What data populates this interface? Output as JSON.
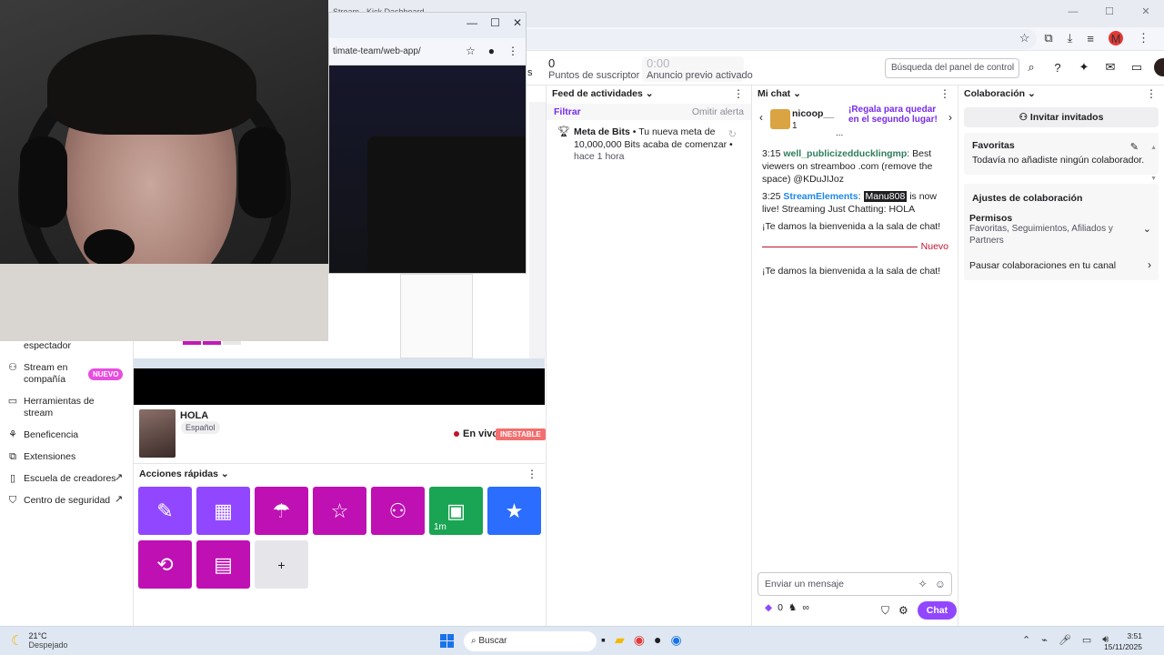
{
  "browser": {
    "tab_title": "Stream - Kick Dashboard",
    "profile_initial": "M",
    "window_controls": [
      "—",
      "☐",
      "✕"
    ]
  },
  "nested_window": {
    "url": "timate-team/web-app/",
    "controls": [
      "—",
      "☐",
      "✕"
    ]
  },
  "top_bar": {
    "stats": [
      {
        "value": "0",
        "label": "Puntos de suscriptor"
      },
      {
        "value": "0:00",
        "label": "Anuncio previo activado"
      }
    ],
    "stat_prefix": "s",
    "search_placeholder": "Búsqueda del panel de control"
  },
  "sidebar": {
    "items": [
      {
        "label": "espectador",
        "icon": "eye-icon"
      },
      {
        "label": "Stream en compañía",
        "icon": "person-plus-icon",
        "badge": "NUEVO"
      },
      {
        "label": "Herramientas de stream",
        "icon": "camera-icon"
      },
      {
        "label": "Beneficencia",
        "icon": "charity-icon"
      },
      {
        "label": "Extensiones",
        "icon": "puzzle-icon"
      },
      {
        "label": "Escuela de creadores",
        "icon": "book-icon",
        "external": true
      },
      {
        "label": "Centro de seguridad",
        "icon": "shield-icon",
        "external": true
      }
    ]
  },
  "stream": {
    "title": "HOLA",
    "language": "Español",
    "status": "En vivo",
    "health": "INESTABLE"
  },
  "quick_actions": {
    "title": "Acciones rápidas",
    "tiles": [
      {
        "icon": "pencil-icon",
        "color": "#9147ff"
      },
      {
        "icon": "clapper-icon",
        "color": "#9147ff"
      },
      {
        "icon": "predictions-icon",
        "color": "#bf10b4"
      },
      {
        "icon": "star-icon",
        "color": "#bf10b4"
      },
      {
        "icon": "add-person-icon",
        "color": "#bf10b4"
      },
      {
        "icon": "ad-icon",
        "color": "#19a553",
        "sub": "1m"
      },
      {
        "icon": "star-icon",
        "color": "#2b6dff"
      },
      {
        "icon": "reset-icon",
        "color": "#bf10b4"
      },
      {
        "icon": "layout-icon",
        "color": "#bf10b4"
      },
      {
        "icon": "plus-icon",
        "color": "#e6e6ea",
        "label": "+"
      }
    ]
  },
  "activity": {
    "title": "Feed de actividades",
    "filter": "Filtrar",
    "skip": "Omitir alerta",
    "event_title": "Meta de Bits",
    "event_text": "Tu nueva meta de 10,000,000 Bits acaba de comenzar",
    "event_time": "hace 1 hora"
  },
  "chat": {
    "title": "Mi chat",
    "gift_user": "nicoop__",
    "gift_count": "1",
    "gift_message": "¡Regala para quedar en el segundo lugar!",
    "gift_more": "...",
    "messages": [
      {
        "time": "3:15",
        "user": "well_publicizedducklingmp",
        "text": "Best viewers on streamboo .com (remove the space) @KDuJIJoz"
      },
      {
        "time": "3:25",
        "user": "StreamElements",
        "mention": "Manu808",
        "text": "is now live! Streaming Just Chatting: HOLA"
      }
    ],
    "welcome": "¡Te damos la bienvenida a la sala de chat!",
    "new_label": "Nuevo",
    "input_placeholder": "Enviar un mensaje",
    "bits": "0",
    "points": "∞",
    "send_label": "Chat"
  },
  "collab": {
    "title": "Colaboración",
    "invite_label": "Invitar invitados",
    "favorites_title": "Favoritas",
    "favorites_text": "Todavía no añadiste ningún colaborador.",
    "settings_title": "Ajustes de colaboración",
    "permissions_title": "Permisos",
    "permissions_text": "Favoritas, Seguimientos, Afiliados y Partners",
    "pause_label": "Pausar colaboraciones en tu canal"
  },
  "taskbar": {
    "temperature": "21°C",
    "weather": "Despejado",
    "search_label": "Buscar",
    "time": "3:51",
    "date": "15/11/2025"
  }
}
